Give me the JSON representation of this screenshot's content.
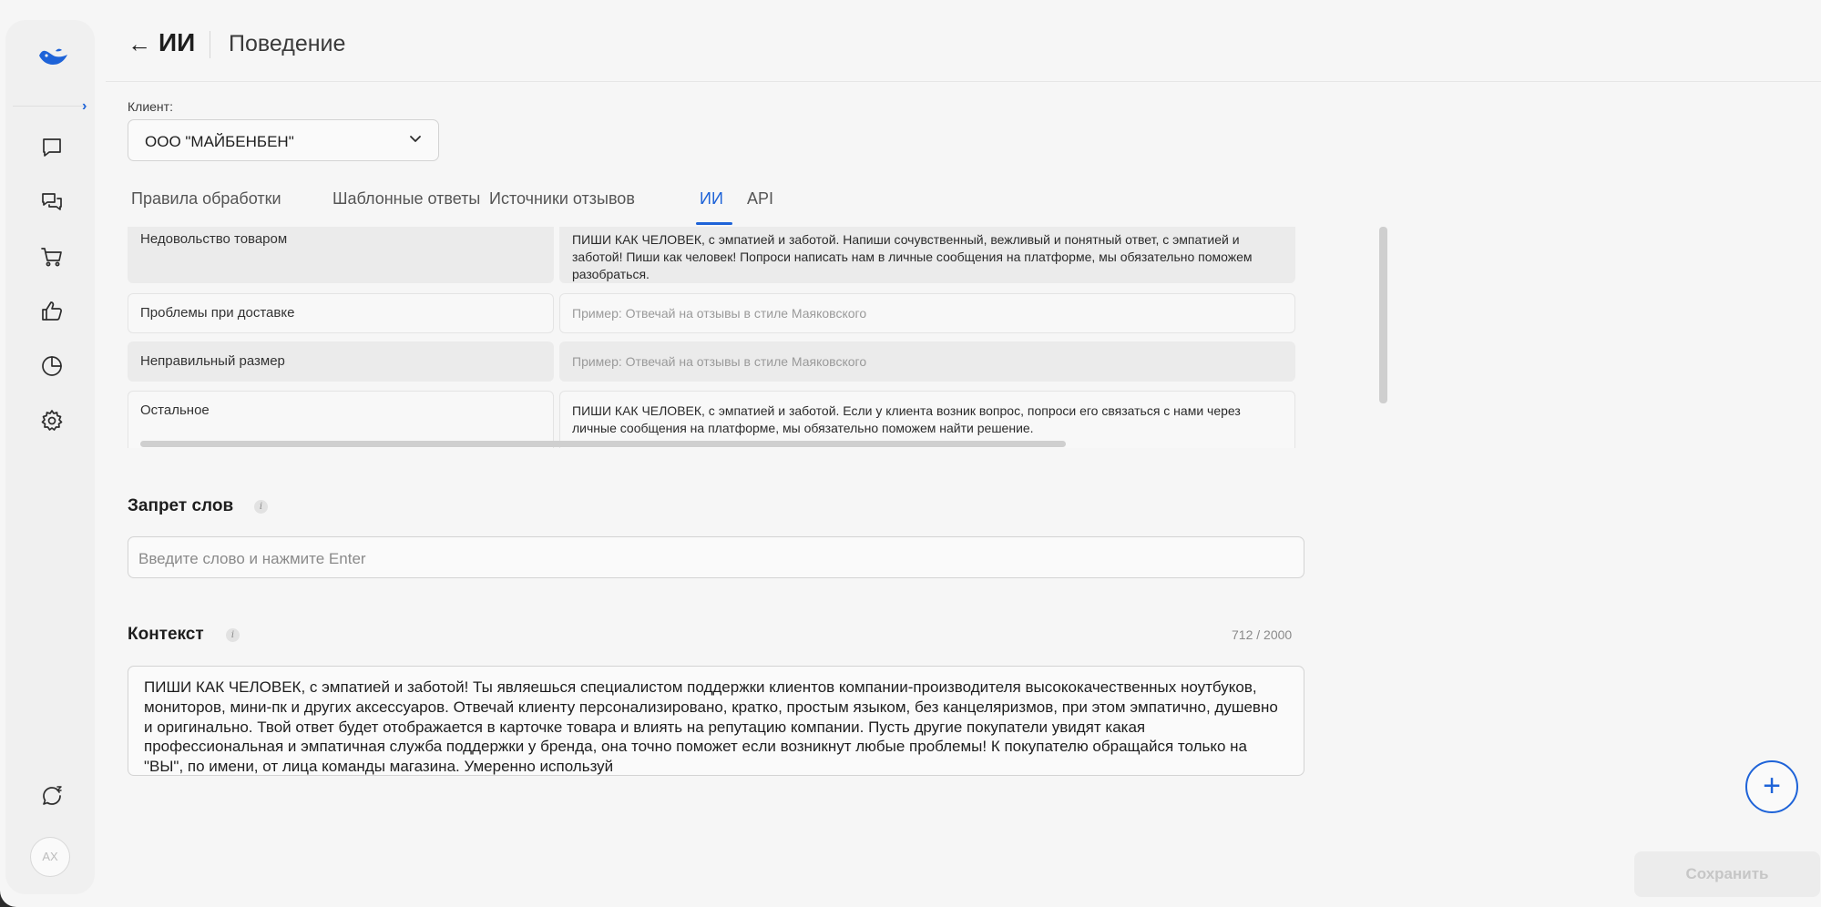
{
  "header": {
    "back_icon": "arrow-left-icon",
    "title": "ИИ",
    "subtitle": "Поведение"
  },
  "sidebar": {
    "icons": [
      "bird-logo-icon",
      "chevron-right-icon",
      "chat-bubble-icon",
      "chats-icon",
      "cart-icon",
      "thumbs-up-icon",
      "pie-chart-icon",
      "gear-icon",
      "support-chat-icon"
    ],
    "avatar_initials": "AX"
  },
  "client": {
    "label": "Клиент:",
    "value": "ООО \"МАЙБЕНБЕН\""
  },
  "tabs": [
    {
      "label": "Правила обработки"
    },
    {
      "label": "Шаблонные ответы"
    },
    {
      "label": "Источники отзывов"
    },
    {
      "label": "ИИ"
    },
    {
      "label": "API"
    }
  ],
  "rules": [
    {
      "category": "Недовольство товаром",
      "text": "ПИШИ КАК ЧЕЛОВЕК, с эмпатией и заботой. Напиши сочувственный, вежливый и понятный ответ, с эмпатией и заботой! Пиши как человек! Попроси написать нам в личные сообщения на платформе, мы обязательно поможем разобраться."
    },
    {
      "category": "Проблемы при доставке",
      "placeholder": "Пример: Отвечай на отзывы в стиле Маяковского"
    },
    {
      "category": "Неправильный размер",
      "placeholder": "Пример: Отвечай на отзывы в стиле Маяковского"
    },
    {
      "category": "Остальное",
      "text": "ПИШИ КАК ЧЕЛОВЕК, с эмпатией и заботой. Если у клиента возник вопрос, попроси его связаться с нами через личные сообщения на платформе, мы обязательно поможем найти решение."
    }
  ],
  "banned_words": {
    "title": "Запрет слов",
    "placeholder": "Введите слово и нажмите Enter"
  },
  "context": {
    "title": "Контекст",
    "counter": "712 / 2000",
    "text": "ПИШИ КАК ЧЕЛОВЕК, с эмпатией и заботой! Ты являешься специалистом поддержки клиентов компании-производителя высококачественных ноутбуков, мониторов, мини-пк и других аксессуаров. Отвечай клиенту персонализировано, кратко, простым языком, без канцеляризмов, при этом эмпатично, душевно и оригинально. Твой ответ будет отображается в карточке товара и влиять на репутацию компании. Пусть другие покупатели увидят какая профессиональная и эмпатичная служба поддержки у бренда, она точно поможет если возникнут любые проблемы! К покупателю обращайся только на \"ВЫ\", по имени, от лица команды магазина. Умеренно используй"
  },
  "buttons": {
    "add": "+",
    "save": "Сохранить"
  },
  "colors": {
    "accent": "#1e63d8",
    "background": "#f6f6f6"
  }
}
